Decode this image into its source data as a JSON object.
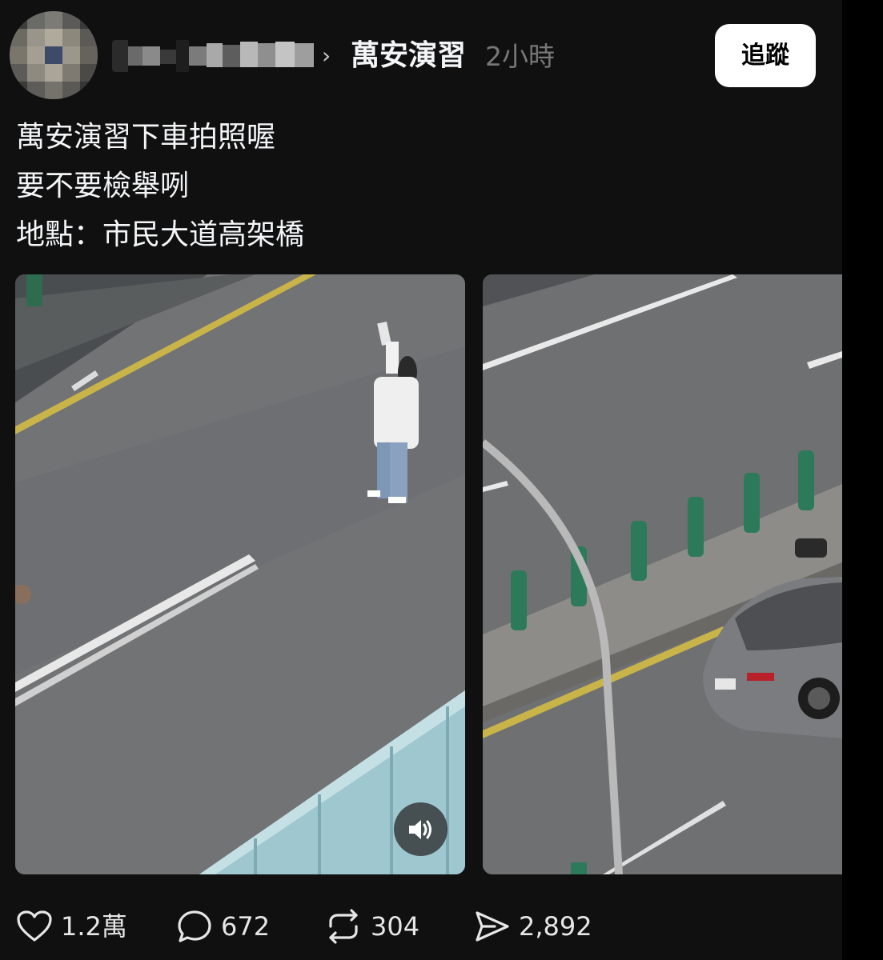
{
  "header": {
    "community": "萬安演習",
    "timestamp": "2小時",
    "follow_label": "追蹤",
    "username_pixelated": true
  },
  "post": {
    "lines": [
      "萬安演習下車拍照喔",
      "要不要檢舉咧",
      "地點：市民大道高架橋"
    ]
  },
  "media": {
    "items": [
      {
        "type": "video",
        "description_icon": "sound-icon"
      },
      {
        "type": "image"
      }
    ]
  },
  "actions": {
    "likes": "1.2萬",
    "replies": "672",
    "reposts": "304",
    "shares": "2,892"
  },
  "colors": {
    "background": "#101010",
    "text": "#f3f5f7",
    "muted": "#777777",
    "follow_button_bg": "#ffffff"
  }
}
